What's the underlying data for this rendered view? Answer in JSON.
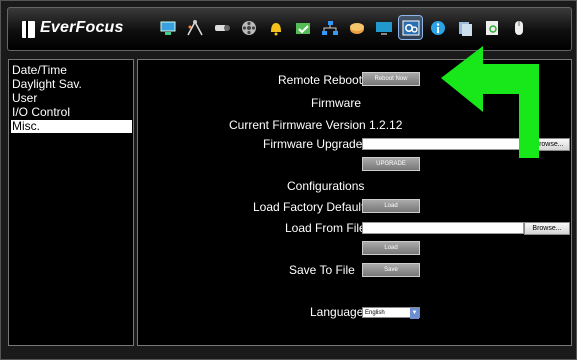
{
  "brand": {
    "name": "EverFocus"
  },
  "toolbar": {
    "icons": [
      "monitor-icon",
      "network-icon",
      "camera-icon",
      "film-reel-icon",
      "alarm-bell-icon",
      "event-icon",
      "lan-icon",
      "storage-icon",
      "display-icon",
      "system-settings-icon",
      "info-icon",
      "logs-icon",
      "report-icon",
      "logout-icon"
    ],
    "active_index": 9
  },
  "sidebar": {
    "items": [
      "Date/Time",
      "Daylight Sav.",
      "User",
      "I/O Control",
      "Misc."
    ],
    "selected_index": 4
  },
  "main": {
    "remote_reboot_label": "Remote Reboot",
    "reboot_now_button": "Reboot Now",
    "firmware_heading": "Firmware",
    "current_version": "Current Firmware Version 1.2.12",
    "firmware_upgrade_label": "Firmware Upgrade",
    "browse_button": "Browse...",
    "upgrade_button": "UPGRADE",
    "configurations_heading": "Configurations",
    "load_factory_label": "Load Factory Default",
    "load_button": "Load",
    "load_from_file_label": "Load From File",
    "load_button_2": "Load",
    "save_to_file_label": "Save To File",
    "save_button": "Save",
    "language_label": "Language",
    "language_value": "English"
  },
  "colors": {
    "accent_arrow": "#18e81a",
    "panel_bg": "#000000",
    "button_gray": "#8a8a8a"
  }
}
